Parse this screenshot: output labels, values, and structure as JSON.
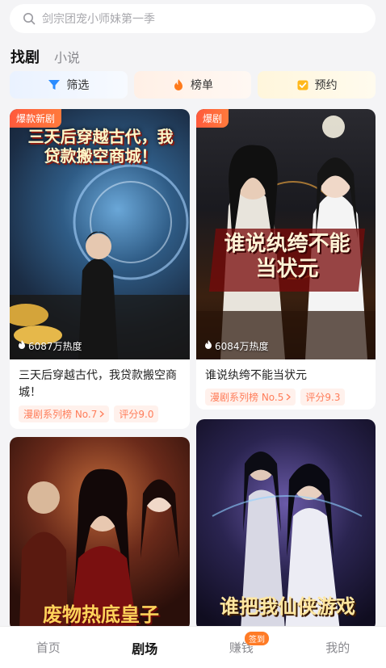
{
  "search": {
    "placeholder": "剑宗团宠小师妹第一季",
    "icon": "search-icon"
  },
  "tabs": [
    {
      "label": "找剧",
      "active": true
    },
    {
      "label": "小说",
      "active": false
    }
  ],
  "filters": [
    {
      "label": "筛选",
      "icon": "funnel-icon",
      "color": "#2b8cff"
    },
    {
      "label": "榜单",
      "icon": "flame-icon",
      "color": "#ff7a1a"
    },
    {
      "label": "预约",
      "icon": "calendar-check-icon",
      "color": "#ffb81c"
    }
  ],
  "cards": [
    {
      "badge": "爆款新剧",
      "heat": "6087万热度",
      "poster_text": "三天后穿越古代，我贷款搬空商城！",
      "title": "三天后穿越古代，我贷款搬空商城！",
      "rank_tag": "漫剧系列榜 No.7",
      "score_tag": "评分9.0"
    },
    {
      "badge": "爆剧",
      "heat": "6084万热度",
      "poster_text": "谁说纨绔不能当状元",
      "title": "谁说纨绔不能当状元",
      "rank_tag": "漫剧系列榜 No.5",
      "score_tag": "评分9.3"
    },
    {
      "poster_text": "废物热底皇子"
    },
    {
      "poster_text": "谁把我仙侠游戏"
    }
  ],
  "bottom_nav": [
    {
      "label": "首页",
      "active": false
    },
    {
      "label": "剧场",
      "active": true
    },
    {
      "label": "赚钱",
      "active": false,
      "badge": "签到"
    },
    {
      "label": "我的",
      "active": false
    }
  ]
}
